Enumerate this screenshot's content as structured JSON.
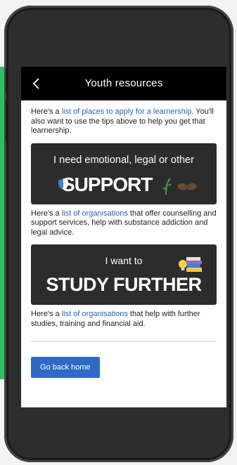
{
  "header": {
    "title": "Youth resources",
    "back_icon": "chevron-left-icon"
  },
  "section1": {
    "text_before": "Here's a ",
    "link": "list of places to apply for a learnership",
    "text_after": ". You'll also want to use the tips above to help you get that learnership."
  },
  "banner_support": {
    "top_text": "I need emotional, legal or other",
    "big_text": "SUPPORT"
  },
  "section2": {
    "text_before": "Here's a ",
    "link": "list of organisations",
    "text_after": " that offer counselling and support services, help with substance addiction and legal advice."
  },
  "banner_study": {
    "top_text": "I want to",
    "big_text": "STUDY FURTHER"
  },
  "section3": {
    "text_before": "Here's a ",
    "link": "list of organisations",
    "text_after": " that help with further studies, training and financial aid."
  },
  "footer": {
    "home_button": "Go back home"
  },
  "colors": {
    "link": "#2e63b5",
    "button": "#2e69c6",
    "banner": "#2c2c2c",
    "accent_green": "#2fbf63"
  }
}
